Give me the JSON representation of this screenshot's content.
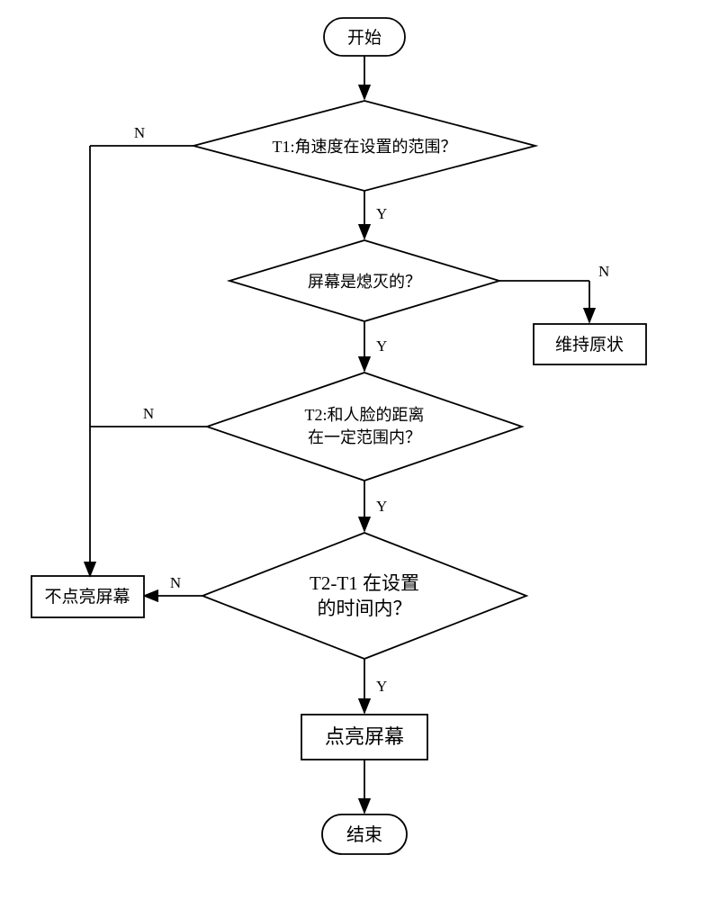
{
  "flowchart": {
    "start": "开始",
    "end": "结束",
    "decision_t1": "T1:角速度在设置的范围？",
    "decision_screen_off": "屏幕是熄灭的？",
    "decision_t2_line1": "T2:和人脸的距离",
    "decision_t2_line2": "在一定范围内？",
    "decision_time_line1": "T2-T1 在设置",
    "decision_time_line2": "的时间内？",
    "process_light": "点亮屏幕",
    "process_no_light": "不点亮屏幕",
    "process_maintain": "维持原状",
    "label_yes": "Y",
    "label_no": "N"
  }
}
